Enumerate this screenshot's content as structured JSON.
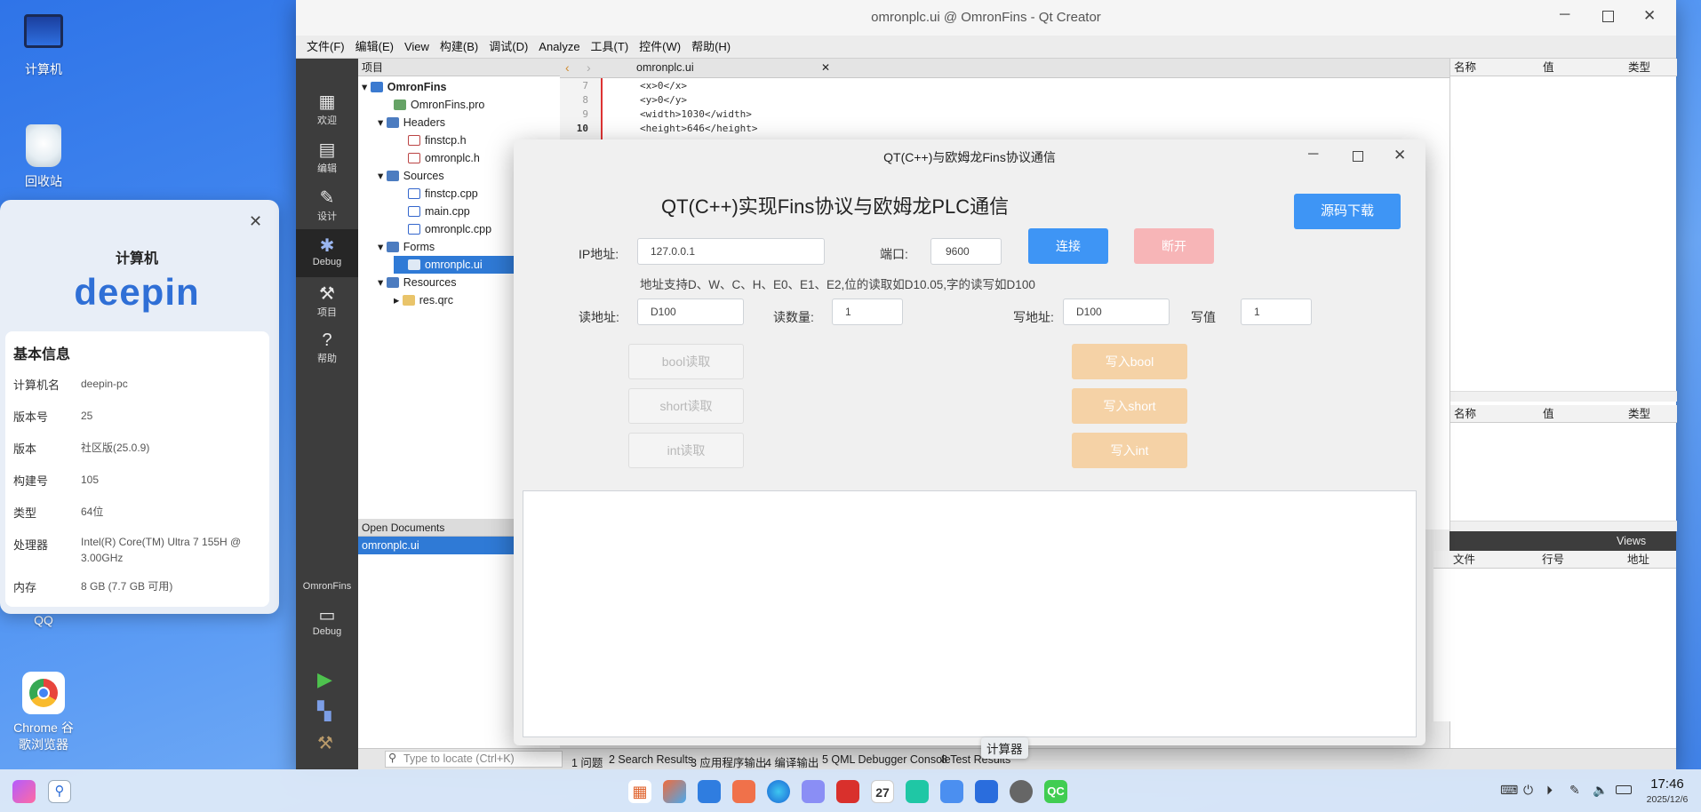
{
  "desktop": {
    "icons": [
      {
        "label": "计算机"
      },
      {
        "label": "回收站"
      },
      {
        "label": "QQ"
      },
      {
        "label": "Chrome 谷\n歌浏览器"
      }
    ]
  },
  "info_panel": {
    "title": "计算机",
    "logo_text": "deepin",
    "section": "基本信息",
    "rows": [
      {
        "k": "计算机名",
        "v": "deepin-pc"
      },
      {
        "k": "版本号",
        "v": "25"
      },
      {
        "k": "版本",
        "v": "社区版(25.0.9)"
      },
      {
        "k": "构建号",
        "v": "105"
      },
      {
        "k": "类型",
        "v": "64位"
      },
      {
        "k": "处理器",
        "v": "Intel(R) Core(TM) Ultra 7 155H @ 3.00GHz"
      },
      {
        "k": "内存",
        "v": "8 GB (7.7 GB 可用)"
      }
    ]
  },
  "qt": {
    "title": "omronplc.ui @ OmronFins - Qt Creator",
    "menu": [
      "文件(F)",
      "编辑(E)",
      "View",
      "构建(B)",
      "调试(D)",
      "Analyze",
      "工具(T)",
      "控件(W)",
      "帮助(H)"
    ],
    "modes": [
      "欢迎",
      "编辑",
      "设计",
      "Debug",
      "项目",
      "帮助"
    ],
    "kit_project": "OmronFins",
    "kit_mode": "Debug",
    "project_header": "项目",
    "tree": [
      "OmronFins",
      "OmronFins.pro",
      "Headers",
      "finstcp.h",
      "omronplc.h",
      "Sources",
      "finstcp.cpp",
      "main.cpp",
      "omronplc.cpp",
      "Forms",
      "omronplc.ui",
      "Resources",
      "res.qrc"
    ],
    "open_docs_header": "Open Documents",
    "open_docs": [
      "omronplc.ui"
    ],
    "editor_tab": "omronplc.ui",
    "code_lines": [
      {
        "n": "7",
        "t": "<x>0</x>"
      },
      {
        "n": "8",
        "t": "<y>0</y>"
      },
      {
        "n": "9",
        "t": "<width>1030</width>"
      },
      {
        "n": "10",
        "t": "<height>646</height>"
      }
    ],
    "prop_cols": [
      "名称",
      "值",
      "类型"
    ],
    "bottom_cols": [
      "文件",
      "行号",
      "地址"
    ],
    "views_label": "Views",
    "locator_placeholder": "Type to locate (Ctrl+K)",
    "output_tabs": [
      "1 问题",
      "2 Search Results",
      "3 应用程序输出",
      "4 编译输出",
      "5 QML Debugger Console",
      "8 Test Results"
    ]
  },
  "dialog": {
    "title": "QT(C++)与欧姆龙Fins协议通信",
    "heading": "QT(C++)实现Fins协议与欧姆龙PLC通信",
    "download_btn": "源码下载",
    "ip_label": "IP地址:",
    "ip_value": "127.0.0.1",
    "port_label": "端口:",
    "port_value": "9600",
    "connect_btn": "连接",
    "disconnect_btn": "断开",
    "hint": "地址支持D、W、C、H、E0、E1、E2,位的读取如D10.05,字的读写如D100",
    "read_addr_label": "读地址:",
    "read_addr_value": "D100",
    "read_count_label": "读数量:",
    "read_count_value": "1",
    "write_addr_label": "写地址:",
    "write_addr_value": "D100",
    "write_value_label": "写值",
    "write_value": "1",
    "read_bool": "bool读取",
    "read_short": "short读取",
    "read_int": "int读取",
    "write_bool": "写入bool",
    "write_short": "写入short",
    "write_int": "写入int"
  },
  "taskbar": {
    "tooltip": "计算器",
    "time": "17:46",
    "date": "2025/12/6",
    "calendar_day": "27"
  }
}
